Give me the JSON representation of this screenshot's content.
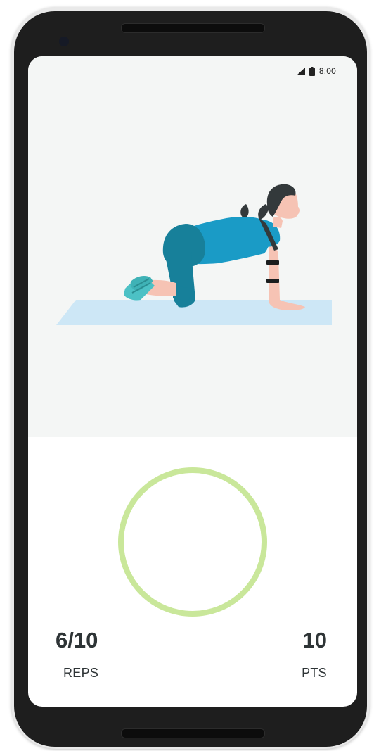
{
  "status_bar": {
    "time": "8:00",
    "icons": [
      "cellular-signal-icon",
      "battery-icon"
    ]
  },
  "illustration": {
    "subject": "woman-on-hands-and-knees-on-yoga-mat",
    "colors": {
      "mat": "#cde7f6",
      "shirt": "#1a9bc6",
      "pants": "#17809a",
      "skin": "#f6c3b4",
      "hair": "#33393b",
      "shoes": "#4cc1c5"
    }
  },
  "progress": {
    "ring_color": "#c9e79a",
    "fraction": 0.6
  },
  "stats": {
    "reps_value": "6/10",
    "reps_label": "REPS",
    "points_value": "10",
    "points_label": "PTS"
  }
}
